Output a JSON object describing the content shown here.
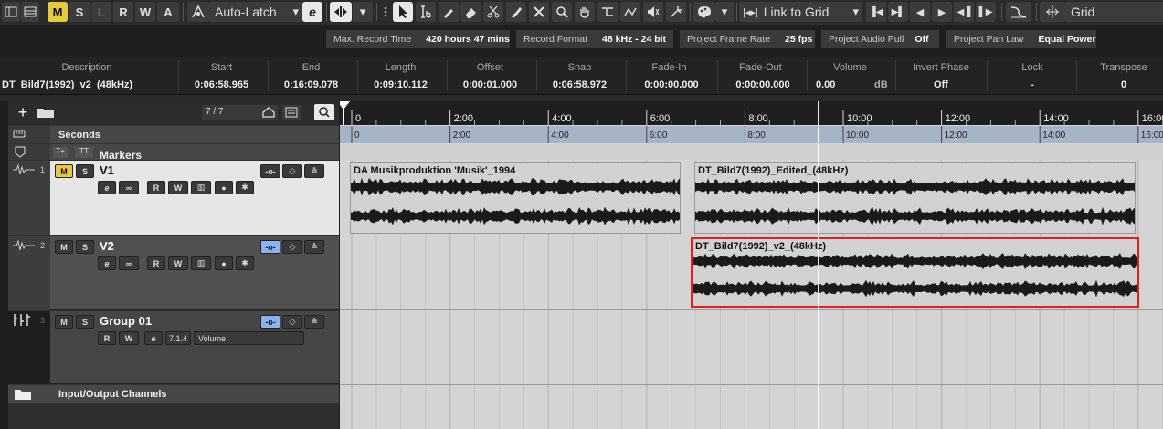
{
  "toolbar": {
    "m": "M",
    "s": "S",
    "l": "L",
    "r": "R",
    "w": "W",
    "a": "A",
    "automation_mode": "Auto-Latch",
    "snap_type": "Link to Grid",
    "grid_type": "Grid"
  },
  "status": [
    {
      "label": "Max. Record Time",
      "value": "420 hours 47 mins"
    },
    {
      "label": "Record Format",
      "value": "48 kHz - 24 bit"
    },
    {
      "label": "Project Frame Rate",
      "value": "25 fps"
    },
    {
      "label": "Project Audio Pull",
      "value": "Off"
    },
    {
      "label": "Project Pan Law",
      "value": "Equal Power"
    }
  ],
  "infoline": {
    "headers": [
      "Description",
      "Start",
      "End",
      "Length",
      "Offset",
      "Snap",
      "Fade-In",
      "Fade-Out",
      "Volume",
      "Invert Phase",
      "Lock",
      "Transpose"
    ],
    "description": "DT_Bild7(1992)_v2_(48kHz)",
    "start": "0:06:58.965",
    "end": "0:16:09.078",
    "length": "0:09:10.112",
    "offset": "0:00:01.000",
    "snap": "0:06:58.972",
    "fade_in": "0:00:00.000",
    "fade_out": "0:00:00.000",
    "volume": "0.00",
    "volume_unit": "dB",
    "invert_phase": "Off",
    "lock": "-",
    "transpose": "0"
  },
  "tracklist": {
    "count": "7 / 7",
    "ruler_name": "Seconds",
    "markers_name": "Markers",
    "io_name": "Input/Output Channels"
  },
  "tracks": [
    {
      "num": "1",
      "name": "V1",
      "m": "M",
      "s": "S",
      "r": "R",
      "w": "W"
    },
    {
      "num": "2",
      "name": "V2",
      "m": "M",
      "s": "S",
      "r": "R",
      "w": "W"
    },
    {
      "num": "3",
      "name": "Group 01",
      "m": "M",
      "s": "S",
      "r": "R",
      "w": "W",
      "channel": "7.1.4",
      "param": "Volume"
    }
  ],
  "ruler": {
    "ticks": [
      "0",
      "2:00",
      "4:00",
      "6:00",
      "8:00",
      "10:00",
      "12:00",
      "14:00",
      "16:00"
    ]
  },
  "events": [
    {
      "name": "DA Musikproduktion 'Musik'_1994"
    },
    {
      "name": "DT_Bild7(1992)_Edited_(48kHz)"
    },
    {
      "name": "DT_Bild7(1992)_v2_(48kHz)"
    }
  ],
  "colors": {
    "selected_event_border": "#e02020",
    "solo_active": "#e8c93c",
    "monitor_active": "#8ab4f0"
  }
}
